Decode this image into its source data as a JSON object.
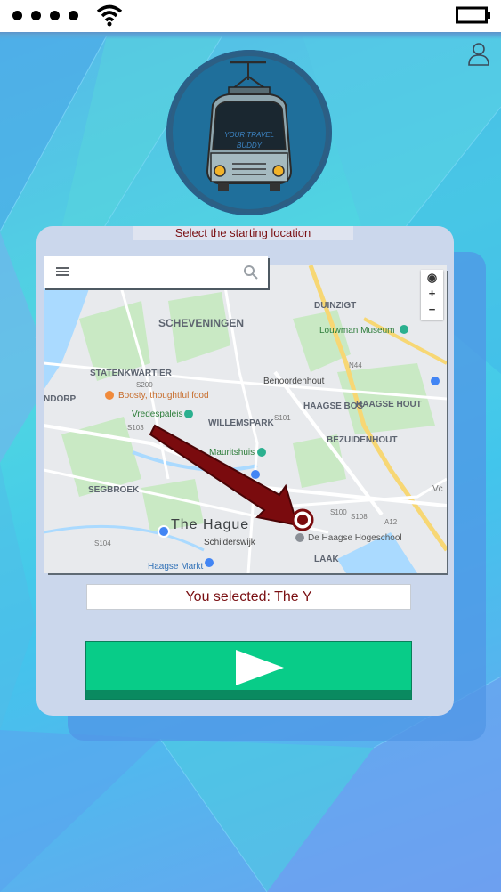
{
  "status_bar": {
    "signal_dots": 4,
    "wifi_icon": "wifi-icon",
    "battery_icon": "battery-icon"
  },
  "header": {
    "user_icon": "user-profile-icon",
    "logo_text_line1": "YOUR TRAVEL",
    "logo_text_line2": "BUDDY"
  },
  "card": {
    "title": "Select the starting location",
    "selected_text": "You selected: The Y",
    "go_button_icon": "play-icon"
  },
  "map": {
    "zoom_in_label": "+",
    "zoom_out_label": "−",
    "labels": {
      "scheveningen": "SCHEVENINGEN",
      "duinzigt": "DUINZIGT",
      "louwman": "Louwman Museum",
      "statenkwartier": "STATENKWARTIER",
      "benoordenhout": "Benoordenhout",
      "boosty": "Boosty, thoughtful food",
      "haagse_bos": "HAAGSE BOS",
      "haagse_hout": "HAAGSE HOUT",
      "vredespaleis": "Vredespaleis",
      "willemspark": "WILLEMSPARK",
      "bezuidenhout": "BEZUIDENHOUT",
      "mauritshuis": "Mauritshuis",
      "segbroek": "SEGBROEK",
      "the_hague": "The Hague",
      "schilderswijk": "Schilderswijk",
      "haagse_hogeschool": "De Haagse Hogeschool",
      "laak": "LAAK",
      "ndorp": "NDORP",
      "haagse_markt": "Haagse Markt",
      "s200": "S200",
      "s103": "S103",
      "s101": "S101",
      "s100": "S100",
      "s108": "S108",
      "s104": "S104",
      "n44": "N44",
      "a12": "A12",
      "vc": "Vc"
    }
  },
  "colors": {
    "accent_text": "#7a0f12",
    "go_button": "#08cc88",
    "arrow": "#7a0b0e"
  }
}
